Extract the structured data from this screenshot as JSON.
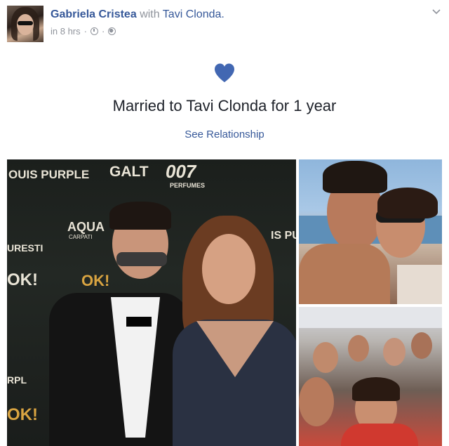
{
  "post": {
    "author": "Gabriela Cristea",
    "with_text": "with",
    "tagged": "Tavi Clonda.",
    "time": "in 8 hrs",
    "separator": "·",
    "privacy_icon": "globe-icon",
    "clock_icon": "clock-icon",
    "menu_icon": "chevron-down-icon"
  },
  "milestone": {
    "icon": "heart-icon",
    "heart_color": "#4267b2",
    "text": "Married to Tavi Clonda for 1 year",
    "link": "See Relationship"
  },
  "photos": {
    "main": {
      "backdrop_texts": [
        "OUIS PURPLE",
        "GALT",
        "007",
        "PERFUMES",
        "AQUA",
        "CARPATI",
        "URESTI",
        "OK!",
        "IS PU",
        "RPL"
      ]
    }
  },
  "colors": {
    "link": "#365899",
    "muted": "#90949c",
    "text": "#1d2129"
  }
}
